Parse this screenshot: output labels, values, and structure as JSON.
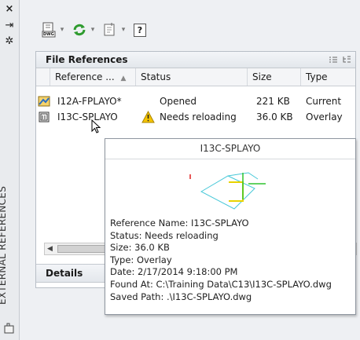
{
  "side": {
    "vertical_title": "EXTERNAL REFERENCES",
    "close_glyph": "×",
    "autohide_glyph": "⇥",
    "properties_glyph": "✲"
  },
  "toolbar": {
    "attach_icon": "attach-dwg-icon",
    "attach_label": "DWG",
    "refresh_icon": "refresh-icon",
    "change_path_icon": "change-path-icon",
    "help_glyph": "?",
    "dropdown_glyph": "▾"
  },
  "panel": {
    "title": "File References",
    "view_icons": [
      "list-view-icon",
      "tree-view-icon"
    ],
    "columns": [
      "Reference ...",
      "Status",
      "Size",
      "Type"
    ],
    "sort_glyph": "▲",
    "rows": [
      {
        "icon": "drawing-file-icon",
        "name": "I12A-FPLAYO*",
        "status": "Opened",
        "size": "221 KB",
        "type": "Current",
        "warning": false
      },
      {
        "icon": "xref-file-icon",
        "name": "I13C-SPLAYO",
        "status": "Needs reloading",
        "size": "36.0 KB",
        "type": "Overlay",
        "warning": true
      }
    ],
    "details_label": "Details"
  },
  "tooltip": {
    "title": "I13C-SPLAYO",
    "lines": [
      "Reference Name: I13C-SPLAYO",
      "Status: Needs reloading",
      "Size: 36.0 KB",
      "Type: Overlay",
      "Date: 2/17/2014 9:18:00 PM",
      "Found At: C:\\Training Data\\C13\\I13C-SPLAYO.dwg",
      "Saved Path: .\\I13C-SPLAYO.dwg"
    ]
  },
  "colors": {
    "accent_blue": "#2d6fc3",
    "refresh_green": "#2e9b2e",
    "warning_yellow": "#f5c400"
  }
}
